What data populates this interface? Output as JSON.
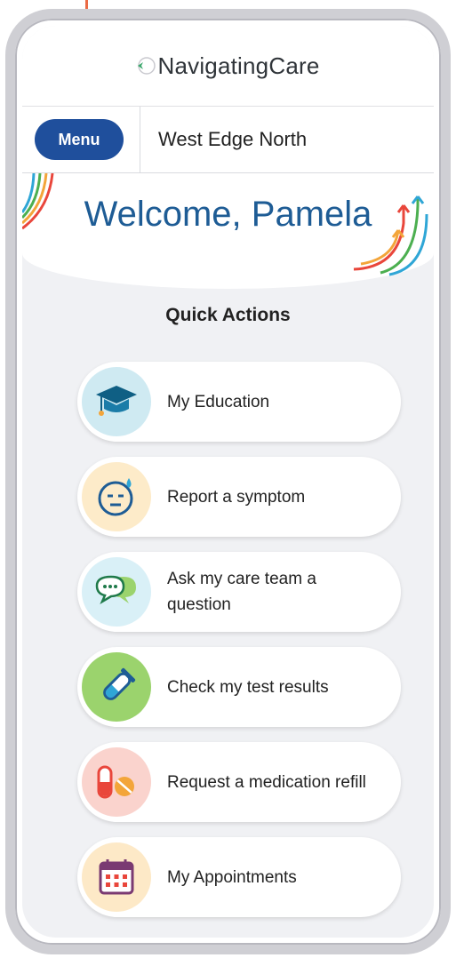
{
  "header": {
    "logo_text": "NavigatingCare"
  },
  "topbar": {
    "menu_label": "Menu",
    "location": "West Edge North"
  },
  "welcome": {
    "text": "Welcome, Pamela"
  },
  "quick_actions": {
    "title": "Quick Actions",
    "items": [
      {
        "label": "My Education",
        "icon": "graduation-cap-icon",
        "icon_bg": "#cfeaf2"
      },
      {
        "label": "Report a symptom",
        "icon": "sweating-face-icon",
        "icon_bg": "#fdebc9"
      },
      {
        "label": "Ask my care team a question",
        "icon": "speech-bubbles-icon",
        "icon_bg": "#d9f0f7"
      },
      {
        "label": "Check my test results",
        "icon": "test-tube-icon",
        "icon_bg": "#9bd36d"
      },
      {
        "label": "Request a medication refill",
        "icon": "pill-icon",
        "icon_bg": "#fad3cd"
      },
      {
        "label": "My Appointments",
        "icon": "calendar-icon",
        "icon_bg": "#fde9c7"
      }
    ]
  },
  "colors": {
    "menu_button": "#1f4f9c",
    "welcome_text": "#1e5c95",
    "pointer": "#ea6a45"
  }
}
